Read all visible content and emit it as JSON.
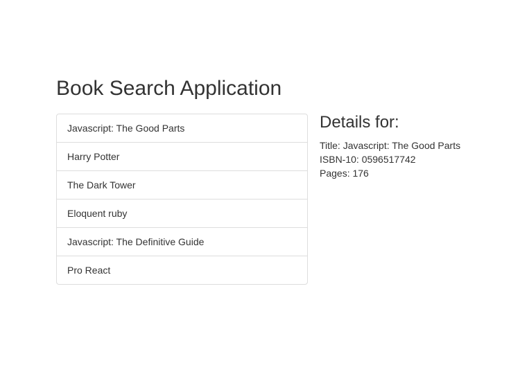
{
  "app": {
    "title": "Book Search Application"
  },
  "books": [
    {
      "label": "Javascript: The Good Parts"
    },
    {
      "label": "Harry Potter"
    },
    {
      "label": "The Dark Tower"
    },
    {
      "label": "Eloquent ruby"
    },
    {
      "label": "Javascript: The Definitive Guide"
    },
    {
      "label": "Pro React"
    }
  ],
  "details": {
    "heading": "Details for:",
    "title_line": "Title: Javascript: The Good Parts",
    "isbn_line": "ISBN-10: 0596517742",
    "pages_line": "Pages: 176"
  }
}
